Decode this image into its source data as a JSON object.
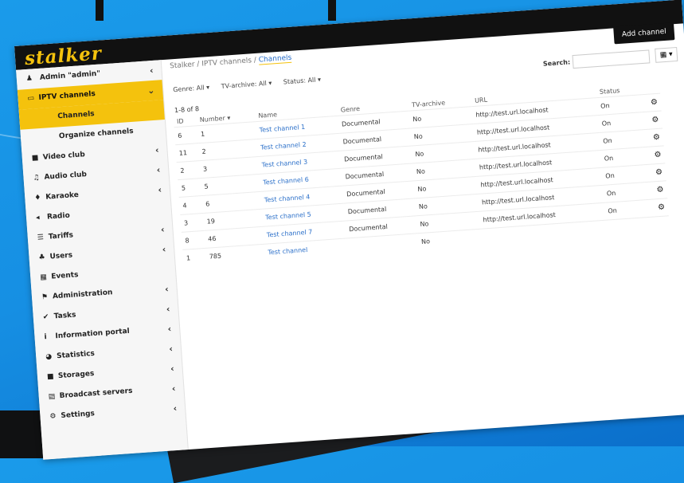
{
  "app": {
    "logo": "stalker"
  },
  "sidebar": {
    "user_label": "Admin \"admin\"",
    "items": [
      {
        "label": "IPTV channels",
        "icon": "tv-icon",
        "active": true,
        "chevron": "⌄"
      },
      {
        "label": "Channels",
        "sub": true,
        "active": true
      },
      {
        "label": "Organize channels",
        "sub": true
      },
      {
        "label": "Video club",
        "icon": "video-icon",
        "chevron": "‹"
      },
      {
        "label": "Audio club",
        "icon": "music-icon",
        "chevron": "‹"
      },
      {
        "label": "Karaoke",
        "icon": "microphone-icon",
        "chevron": "‹"
      },
      {
        "label": "Radio",
        "icon": "radio-icon"
      },
      {
        "label": "Tariffs",
        "icon": "list-icon",
        "chevron": "‹"
      },
      {
        "label": "Users",
        "icon": "users-icon",
        "chevron": "‹"
      },
      {
        "label": "Events",
        "icon": "calendar-icon"
      },
      {
        "label": "Administration",
        "icon": "admin-icon",
        "chevron": "‹"
      },
      {
        "label": "Tasks",
        "icon": "check-icon",
        "chevron": "‹"
      },
      {
        "label": "Information portal",
        "icon": "info-icon",
        "chevron": "‹"
      },
      {
        "label": "Statistics",
        "icon": "pie-chart-icon",
        "chevron": "‹"
      },
      {
        "label": "Storages",
        "icon": "storage-icon",
        "chevron": "‹"
      },
      {
        "label": "Broadcast servers",
        "icon": "server-icon",
        "chevron": "‹"
      },
      {
        "label": "Settings",
        "icon": "settings-icon",
        "chevron": "‹"
      }
    ]
  },
  "header": {
    "breadcrumb": [
      "Stalker",
      "IPTV channels",
      "Channels"
    ],
    "add_button": "Add channel"
  },
  "filters": {
    "genre": "Genre: All ▾",
    "archive": "TV-archive: All ▾",
    "status": "Status: All ▾",
    "search_label": "Search:",
    "grid_button": "▦ ▾"
  },
  "table": {
    "count": "1-8 of 8",
    "columns": [
      "ID",
      "Number",
      "Name",
      "Genre",
      "TV-archive",
      "URL",
      "Status"
    ],
    "rows": [
      {
        "id": "6",
        "number": "1",
        "name": "Test channel 1",
        "genre": "Documental",
        "archive": "No",
        "url": "http://test.url.localhost",
        "status": "On"
      },
      {
        "id": "11",
        "number": "2",
        "name": "Test channel 2",
        "genre": "Documental",
        "archive": "No",
        "url": "http://test.url.localhost",
        "status": "On"
      },
      {
        "id": "2",
        "number": "3",
        "name": "Test channel 3",
        "genre": "Documental",
        "archive": "No",
        "url": "http://test.url.localhost",
        "status": "On"
      },
      {
        "id": "5",
        "number": "5",
        "name": "Test channel 6",
        "genre": "Documental",
        "archive": "No",
        "url": "http://test.url.localhost",
        "status": "On"
      },
      {
        "id": "4",
        "number": "6",
        "name": "Test channel 4",
        "genre": "Documental",
        "archive": "No",
        "url": "http://test.url.localhost",
        "status": "On"
      },
      {
        "id": "3",
        "number": "19",
        "name": "Test channel 5",
        "genre": "Documental",
        "archive": "No",
        "url": "http://test.url.localhost",
        "status": "On"
      },
      {
        "id": "8",
        "number": "46",
        "name": "Test channel 7",
        "genre": "Documental",
        "archive": "No",
        "url": "http://test.url.localhost",
        "status": "On"
      },
      {
        "id": "1",
        "number": "785",
        "name": "Test channel",
        "genre": "",
        "archive": "No",
        "url": "",
        "status": ""
      }
    ]
  },
  "colors": {
    "accent": "#f4c20d",
    "link": "#2a6fc9",
    "topbar": "#111111"
  }
}
